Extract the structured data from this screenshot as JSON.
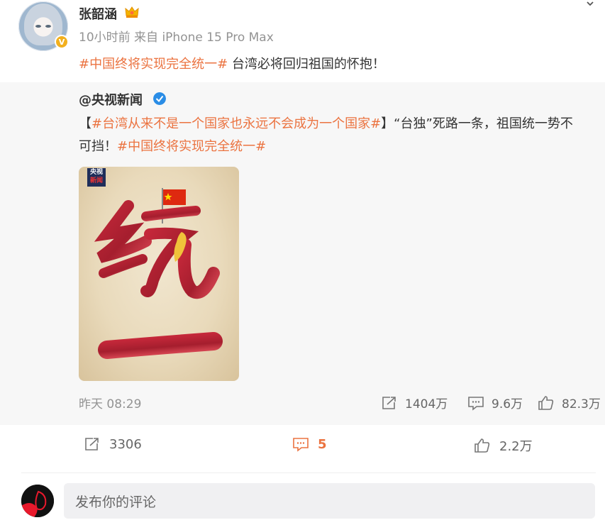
{
  "post": {
    "username": "张韶涵",
    "meta": "10小时前 来自 iPhone 15 Pro Max",
    "topic": "#中国终将实现完全统一#",
    "text": " 台湾必将回归祖国的怀抱！"
  },
  "quote": {
    "username": "@央视新闻",
    "bracket_open": "【",
    "topic1": "#台湾从来不是一个国家也永远不会成为一个国家#",
    "text1": "】“台独”死路一条，祖国统一势不",
    "text2": "可挡！",
    "topic2": "#中国终将实现完全统一#",
    "poster_logo": [
      "央视",
      "新闻"
    ],
    "time": "昨天 08:29",
    "repost_count": "1404万",
    "comment_count": "9.6万",
    "like_count": "82.3万"
  },
  "actions": {
    "repost_count": "3306",
    "comment_count": "5",
    "like_count": "2.2万"
  },
  "comment_box": {
    "placeholder": "发布你的评论"
  },
  "colors": {
    "topic": "#eb7340",
    "verified_gold": "#f2b01e",
    "verified_blue": "#2a8de6",
    "quote_bg": "#f7f7f7",
    "flag_red": "#de2910"
  },
  "icons": [
    "crown-icon",
    "verified-icon",
    "more-chevron-icon",
    "repost-icon",
    "comment-icon",
    "like-icon"
  ]
}
